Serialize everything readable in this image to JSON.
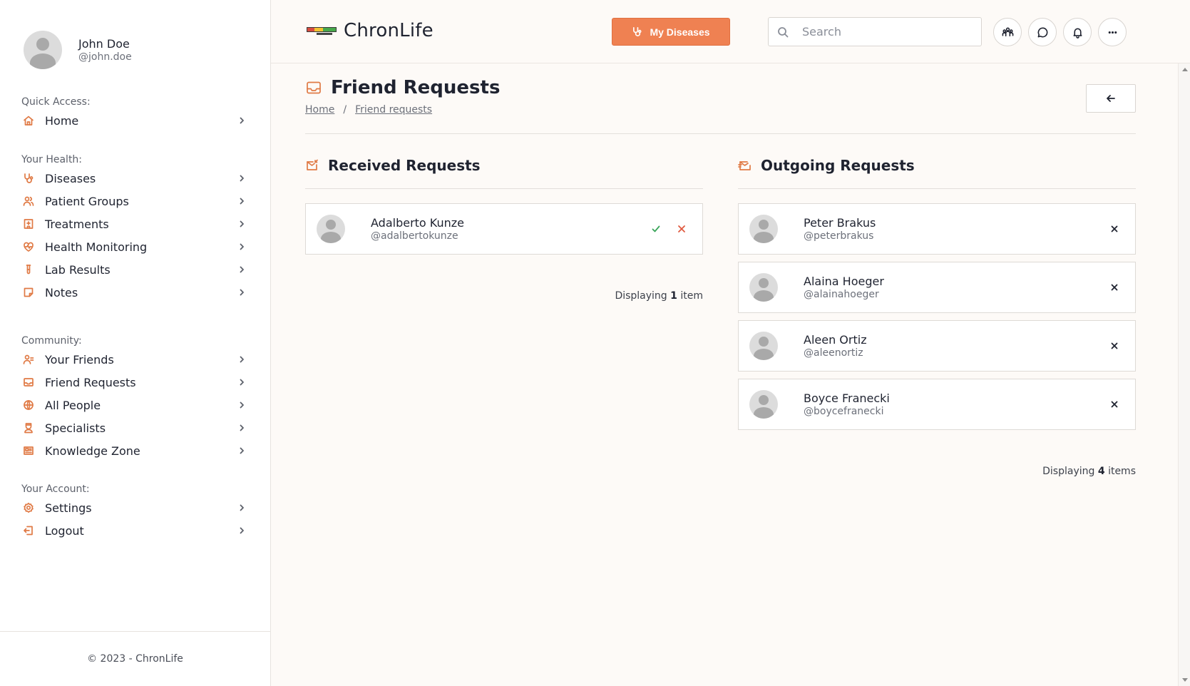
{
  "user": {
    "name": "John Doe",
    "handle": "@john.doe"
  },
  "sidebar": {
    "sections": [
      {
        "heading": "Quick Access:",
        "items": [
          {
            "label": "Home",
            "icon": "home-icon"
          }
        ]
      },
      {
        "heading": "Your Health:",
        "items": [
          {
            "label": "Diseases",
            "icon": "stethoscope-icon"
          },
          {
            "label": "Patient Groups",
            "icon": "users-icon"
          },
          {
            "label": "Treatments",
            "icon": "hospital-icon"
          },
          {
            "label": "Health Monitoring",
            "icon": "heart-pulse-icon"
          },
          {
            "label": "Lab Results",
            "icon": "test-tube-icon"
          },
          {
            "label": "Notes",
            "icon": "note-icon"
          }
        ]
      },
      {
        "heading": "Community:",
        "items": [
          {
            "label": "Your Friends",
            "icon": "user-friends-icon"
          },
          {
            "label": "Friend Requests",
            "icon": "inbox-icon"
          },
          {
            "label": "All People",
            "icon": "globe-icon"
          },
          {
            "label": "Specialists",
            "icon": "doctor-icon"
          },
          {
            "label": "Knowledge Zone",
            "icon": "newspaper-icon"
          }
        ]
      },
      {
        "heading": "Your Account:",
        "items": [
          {
            "label": "Settings",
            "icon": "gear-icon"
          },
          {
            "label": "Logout",
            "icon": "logout-icon"
          }
        ]
      }
    ],
    "footer": "© 2023 - ChronLife"
  },
  "header": {
    "brand": "ChronLife",
    "primary_button": "My Diseases",
    "search_placeholder": "Search",
    "icons": [
      "people-icon",
      "chat-icon",
      "bell-icon",
      "more-icon"
    ]
  },
  "page": {
    "title": "Friend Requests",
    "breadcrumb": {
      "home": "Home",
      "current": "Friend requests"
    }
  },
  "received": {
    "title": "Received Requests",
    "items": [
      {
        "name": "Adalberto Kunze",
        "handle": "@adalbertokunze"
      }
    ],
    "count_prefix": "Displaying",
    "count": "1",
    "count_suffix": "item"
  },
  "outgoing": {
    "title": "Outgoing Requests",
    "items": [
      {
        "name": "Peter Brakus",
        "handle": "@peterbrakus"
      },
      {
        "name": "Alaina Hoeger",
        "handle": "@alainahoeger"
      },
      {
        "name": "Aleen Ortiz",
        "handle": "@aleenortiz"
      },
      {
        "name": "Boyce Franecki",
        "handle": "@boycefranecki"
      }
    ],
    "count_prefix": "Displaying",
    "count": "4",
    "count_suffix": "items"
  },
  "colors": {
    "accent": "#ef8152",
    "icon": "#e07a45",
    "accept": "#3aa55a",
    "reject": "#e05a40"
  }
}
